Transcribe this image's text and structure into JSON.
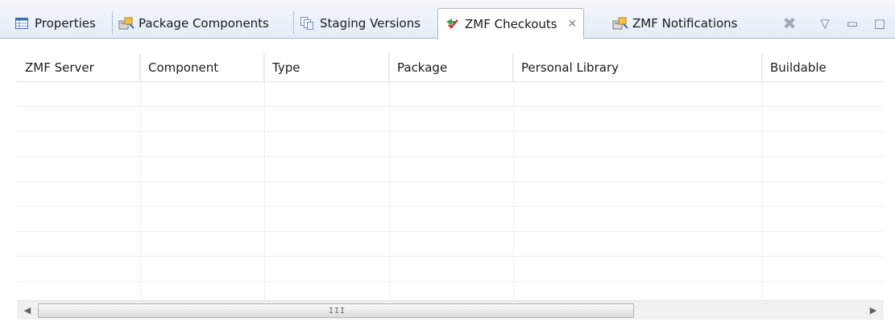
{
  "tabs": [
    {
      "label": "Properties",
      "icon": "properties-table-icon"
    },
    {
      "label": "Package Components",
      "icon": "package-components-icon"
    },
    {
      "label": "Staging Versions",
      "icon": "staging-versions-icon"
    },
    {
      "label": "ZMF Checkouts",
      "icon": "zmf-checkouts-icon",
      "active": true
    },
    {
      "label": "ZMF Notifications",
      "icon": "zmf-notifications-icon"
    }
  ],
  "view_controls": {
    "remove": "✖",
    "menu": "▽",
    "minimize": "▭",
    "maximize": "□"
  },
  "table": {
    "columns": [
      "ZMF Server",
      "Component",
      "Type",
      "Package",
      "Personal Library",
      "Buildable"
    ],
    "rows": []
  },
  "scrollbar": {
    "left_arrow": "◀",
    "right_arrow": "▶",
    "grip": "III"
  },
  "colors": {
    "tab_bar_bg": "#e4ecf6",
    "active_tab_bg": "#ffffff",
    "grid_line": "#ebeef1"
  }
}
